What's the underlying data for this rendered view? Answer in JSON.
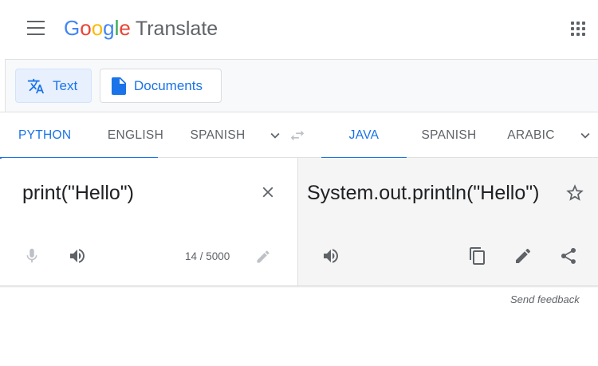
{
  "header": {
    "logo_letters": [
      "G",
      "o",
      "o",
      "g",
      "l",
      "e"
    ],
    "product_name": "Translate",
    "menu_icon": "menu-icon",
    "apps_icon": "apps-grid-icon"
  },
  "mode_bar": {
    "text_label": "Text",
    "documents_label": "Documents"
  },
  "source_languages": [
    "PYTHON",
    "ENGLISH",
    "SPANISH"
  ],
  "target_languages": [
    "JAVA",
    "SPANISH",
    "ARABIC"
  ],
  "source": {
    "text": "print(\"Hello\")",
    "char_count": "14 / 5000"
  },
  "target": {
    "text": "System.out.println(\"Hello\")"
  },
  "footer": {
    "feedback_label": "Send feedback"
  },
  "colors": {
    "accent": "#1a73e8",
    "icon_gray": "#5f6368",
    "disabled_icon": "#bdc1c6",
    "target_bg": "#f5f5f5",
    "google_blue": "#4285f4",
    "google_red": "#ea4335",
    "google_yellow": "#fbbc05",
    "google_green": "#34a853"
  }
}
